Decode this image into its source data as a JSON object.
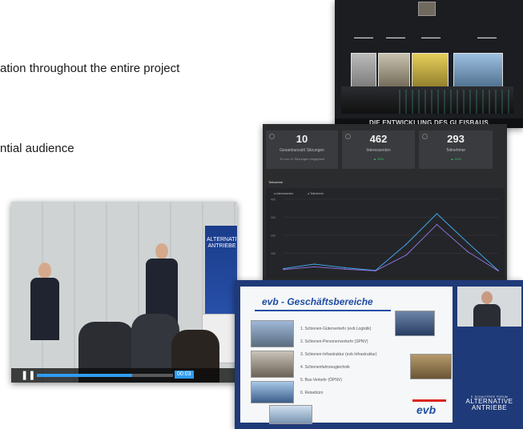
{
  "intro": {
    "line1": "ation throughout the entire project",
    "line2": "ntial audience"
  },
  "presentation": {
    "caption": "DIE ENTWICKLUNG DES GLEISBAUS"
  },
  "dashboard": {
    "stats": [
      {
        "value": "10",
        "label": "Gesamtanzahl Sitzungen",
        "sub": "10 von 10 Sitzungen eingeplant"
      },
      {
        "value": "462",
        "label": "Interessenten",
        "sub": "▲ 25%"
      },
      {
        "value": "293",
        "label": "Teilnehmer",
        "sub": "▲ 44%"
      }
    ],
    "chart": {
      "title": "Teilnahme",
      "legend": [
        "Interessenten",
        "Teilnehmer"
      ],
      "yticks": [
        "400",
        "300",
        "200",
        "100"
      ]
    },
    "chart_data": {
      "type": "line",
      "x": [
        1,
        2,
        3,
        4,
        5,
        6,
        7,
        8
      ],
      "series": [
        {
          "name": "Interessenten",
          "values": [
            15,
            40,
            20,
            5,
            150,
            320,
            160,
            5
          ]
        },
        {
          "name": "Teilnehmer",
          "values": [
            10,
            25,
            12,
            3,
            90,
            260,
            110,
            3
          ]
        }
      ],
      "ylim": [
        0,
        400
      ],
      "colors": [
        "#3fa3e8",
        "#8c6fd8"
      ]
    }
  },
  "video": {
    "banner_lines": [
      "ALTERNATIVE",
      "ANTRIEBE"
    ],
    "time": "00:03",
    "progress": 0.7
  },
  "slide": {
    "title": "evb - Geschäftsbereiche",
    "items": [
      "1. Schienen-Güterverkehr (evb Logistik)",
      "2. Schienen-Personenverkehr (SPNV)",
      "3. Schienen-Infrastruktur (evb Infrastruktur)",
      "4. Schienenfahrzeugtechnik",
      "5. Bus-Verkehr (ÖPNV)",
      "6. Reisebüro"
    ],
    "logo": "evb",
    "brand_small": "5. SCHALTFREE FORUM",
    "brand_line1": "ALTERNATIVE",
    "brand_line2": "ANTRIEBE"
  },
  "colors": {
    "accent": "#2f9cf3",
    "slide_blue": "#1f4ea3",
    "evb_red": "#d9261c",
    "dash_bg": "#2b2c2e"
  }
}
